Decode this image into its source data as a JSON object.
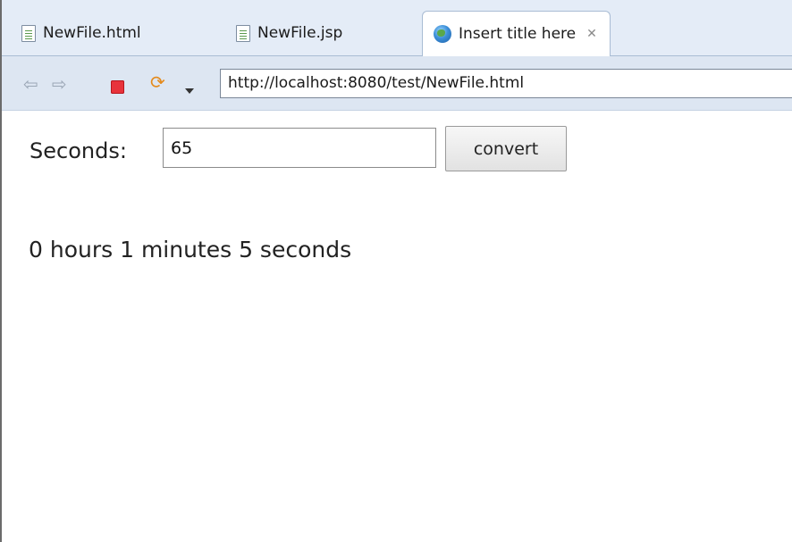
{
  "tabs": [
    {
      "label": "NewFile.html",
      "icon": "html-file-icon"
    },
    {
      "label": "NewFile.jsp",
      "icon": "jsp-file-icon"
    },
    {
      "label": "Insert title here",
      "icon": "globe-icon",
      "active": true
    }
  ],
  "toolbar": {
    "back_icon": "back-arrow-icon",
    "forward_icon": "forward-arrow-icon",
    "stop_icon": "stop-icon",
    "refresh_icon": "refresh-icon",
    "url": "http://localhost:8080/test/NewFile.html"
  },
  "form": {
    "label": "Seconds:",
    "value": "65",
    "button_label": "convert"
  },
  "result": "0 hours 1 minutes 5 seconds",
  "colors": {
    "stop": "#e8333b",
    "toolbar_bg": "#dde6f2",
    "tab_bg": "#e4ecf7"
  }
}
